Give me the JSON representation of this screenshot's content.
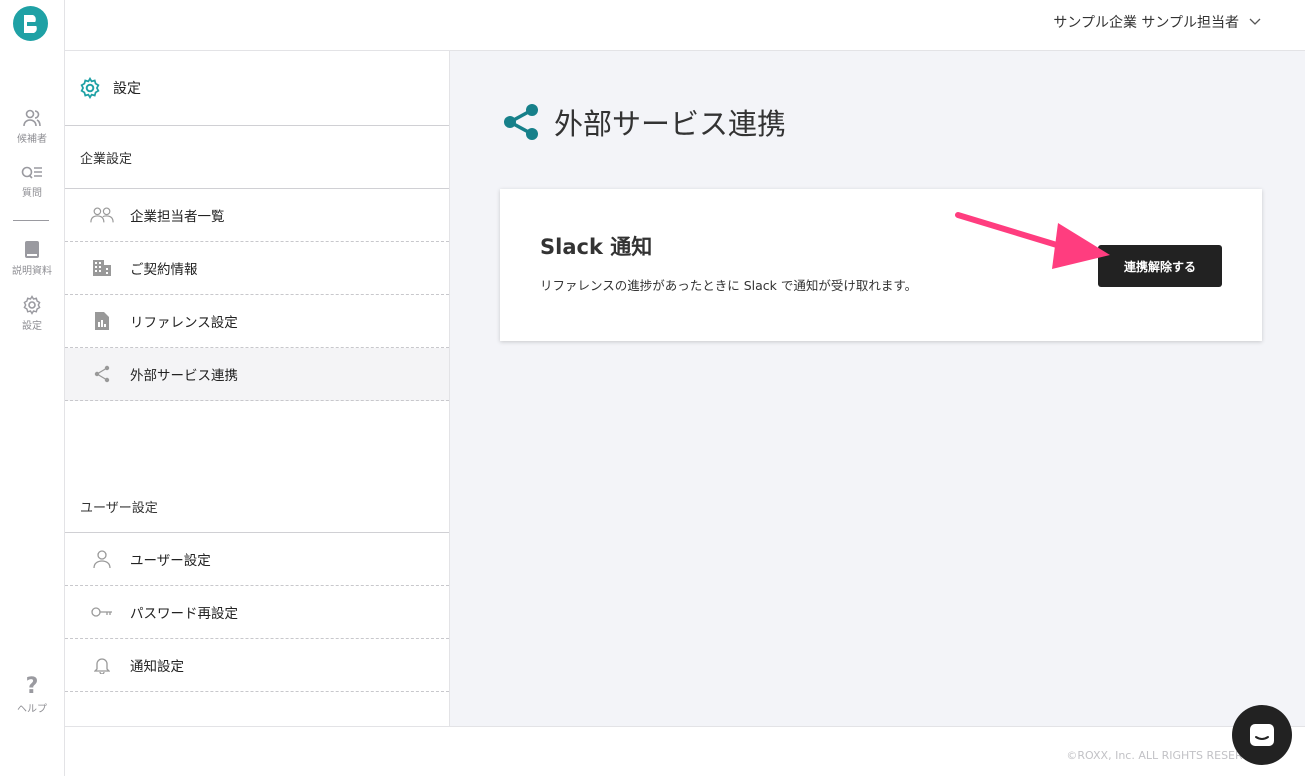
{
  "rail": {
    "items": [
      {
        "label": "候補者",
        "icon": "users-icon"
      },
      {
        "label": "質問",
        "icon": "question-list-icon"
      },
      {
        "label": "説明資料",
        "icon": "book-icon"
      },
      {
        "label": "設定",
        "icon": "gear-icon"
      }
    ],
    "help_label": "ヘルプ"
  },
  "header": {
    "user_menu": "サンプル企業 サンプル担当者"
  },
  "settings_nav": {
    "title": "設定",
    "company_section": "企業設定",
    "company_items": [
      {
        "label": "企業担当者一覧",
        "icon": "users-icon"
      },
      {
        "label": "ご契約情報",
        "icon": "building-icon"
      },
      {
        "label": "リファレンス設定",
        "icon": "document-chart-icon"
      },
      {
        "label": "外部サービス連携",
        "icon": "share-icon"
      }
    ],
    "user_section": "ユーザー設定",
    "user_items": [
      {
        "label": "ユーザー設定",
        "icon": "person-icon"
      },
      {
        "label": "パスワード再設定",
        "icon": "key-icon"
      },
      {
        "label": "通知設定",
        "icon": "bell-icon"
      }
    ]
  },
  "main": {
    "title": "外部サービス連携",
    "card": {
      "title": "Slack 通知",
      "description": "リファレンスの進捗があったときに Slack で通知が受け取れます。",
      "button_label": "連携解除する"
    }
  },
  "footer": {
    "copyright": "©ROXX, Inc. ALL RIGHTS RESERVED"
  },
  "colors": {
    "accent": "#1fa1a5",
    "teal_dark": "#16808a",
    "button": "#222222",
    "annotation_arrow": "#ff3d7f"
  }
}
